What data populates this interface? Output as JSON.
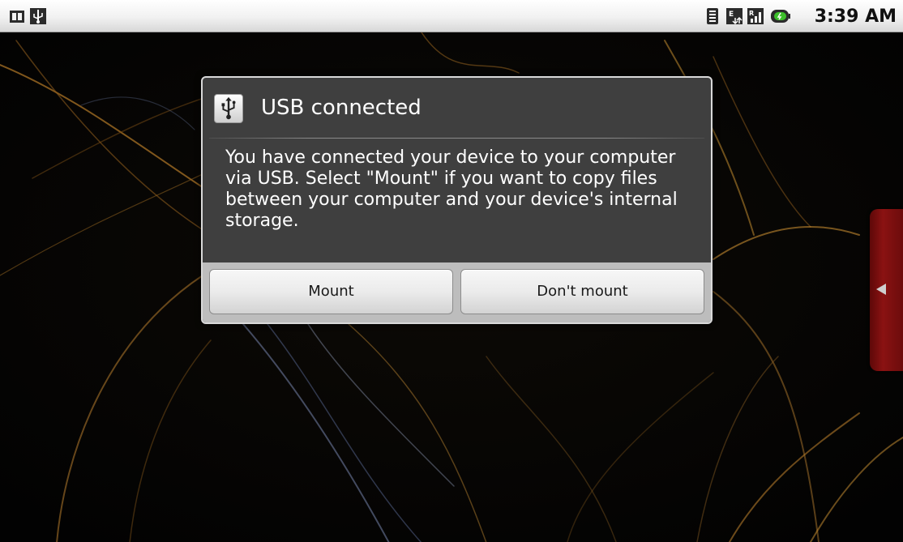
{
  "status_bar": {
    "time": "3:39 AM",
    "left_icons": [
      "sd-card-icon",
      "usb-icon"
    ],
    "right_icons": [
      "wifi-signal-icon",
      "data-transfer-icon",
      "cell-signal-icon",
      "battery-icon"
    ]
  },
  "dialog": {
    "icon": "usb-icon",
    "title": "USB connected",
    "message": "You have connected your device to your computer via USB. Select \"Mount\" if you want to copy files between your computer and your device's internal storage.",
    "buttons": {
      "mount": "Mount",
      "dont_mount": "Don't mount"
    }
  },
  "side_handle": {
    "icon": "triangle-left-icon"
  },
  "colors": {
    "dialog_background": "#3f3f3f",
    "button_bar": "#bdbdbd",
    "side_handle": "#8a1212"
  }
}
